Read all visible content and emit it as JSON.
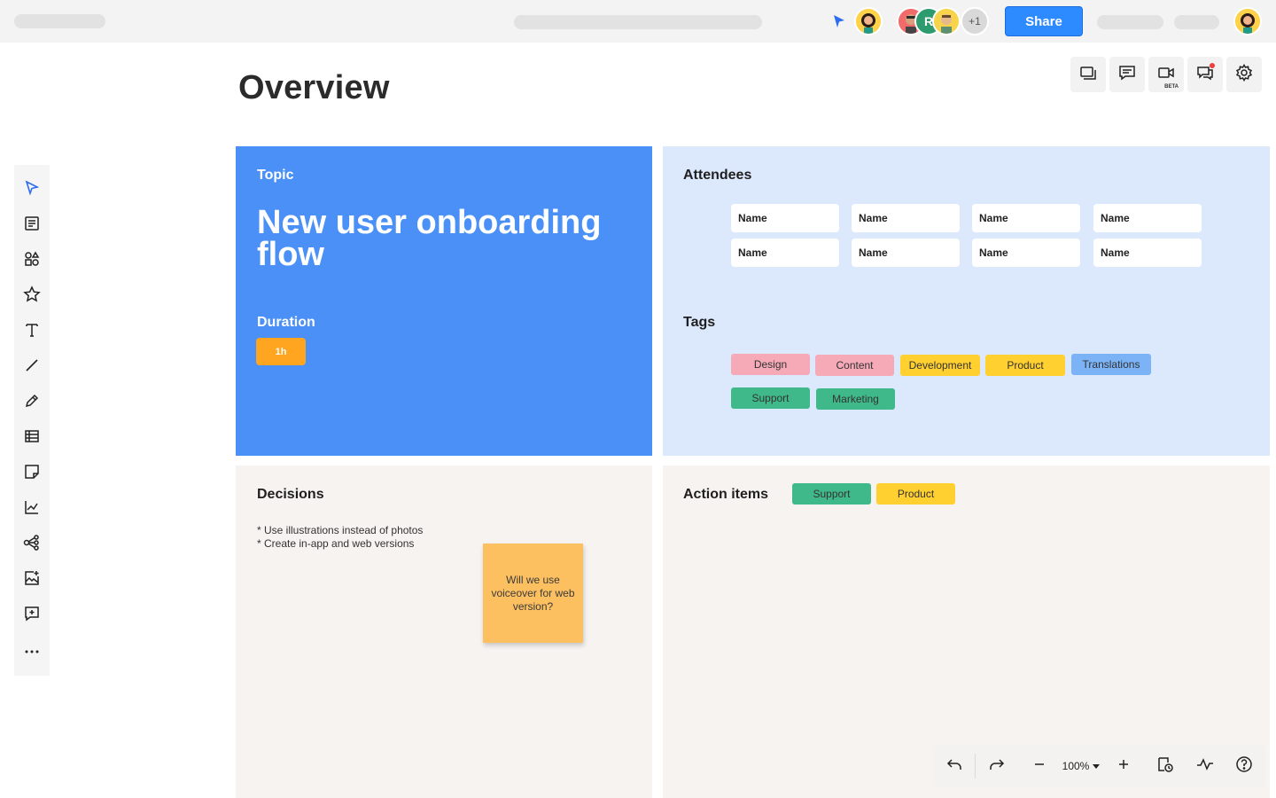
{
  "topbar": {
    "share_label": "Share",
    "collab_initial": "R",
    "extra_count": "+1"
  },
  "page": {
    "title": "Overview"
  },
  "top_tools": [
    {
      "name": "frames-icon"
    },
    {
      "name": "comment-icon"
    },
    {
      "name": "video-icon",
      "badge": "BETA"
    },
    {
      "name": "chat-icon"
    },
    {
      "name": "settings-icon"
    }
  ],
  "topic": {
    "label": "Topic",
    "value": "New user onboarding flow",
    "duration_label": "Duration",
    "duration_value": "1h"
  },
  "attendees": {
    "label": "Attendees",
    "names": [
      "Name",
      "Name",
      "Name",
      "Name",
      "Name",
      "Name",
      "Name",
      "Name"
    ]
  },
  "tags": {
    "label": "Tags",
    "items": [
      {
        "label": "Design",
        "color": "#f6a9b7"
      },
      {
        "label": "Content",
        "color": "#f6a9b7"
      },
      {
        "label": "Development",
        "color": "#ffd02f"
      },
      {
        "label": "Product",
        "color": "#ffd02f"
      },
      {
        "label": "Translations",
        "color": "#7bb3f6"
      },
      {
        "label": "Support",
        "color": "#3fb88a"
      },
      {
        "label": "Marketing",
        "color": "#3fb88a"
      }
    ]
  },
  "decisions": {
    "label": "Decisions",
    "line1": "* Use illustrations instead of photos",
    "line2": "* Create in-app and web versions",
    "sticky": "Will we use voiceover for web version?"
  },
  "action_items": {
    "label": "Action items",
    "tags": [
      {
        "label": "Support",
        "color": "#3fb88a"
      },
      {
        "label": "Product",
        "color": "#ffd02f"
      }
    ]
  },
  "bottombar": {
    "zoom": "100%"
  },
  "colors": {
    "accent": "#2d8bff",
    "topic_bg": "#4a90f7",
    "attendees_bg": "#dce9fd",
    "neutral_bg": "#f6f3f1",
    "duration_chip": "#ffa51f",
    "sticky": "#fcc061"
  }
}
